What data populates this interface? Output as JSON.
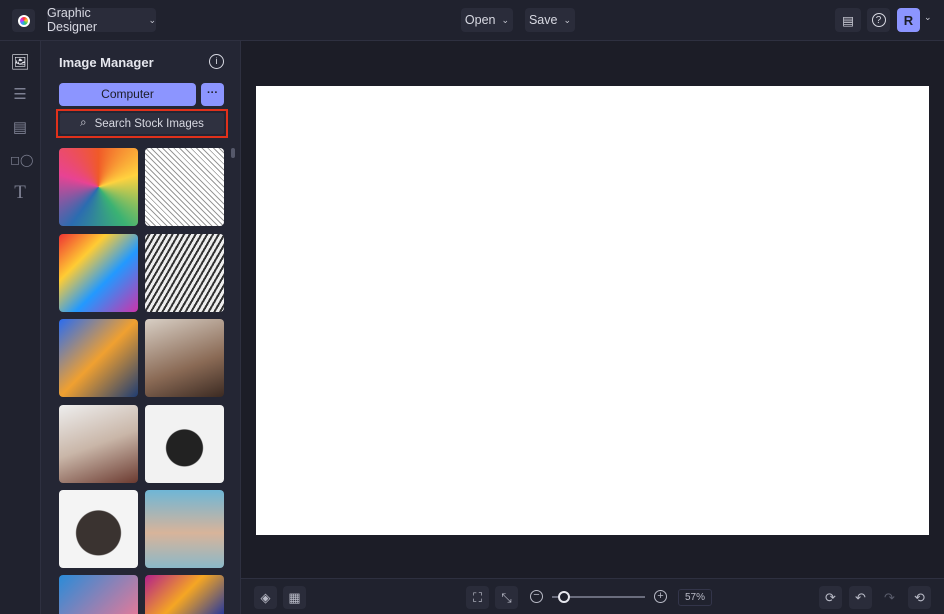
{
  "header": {
    "workspace": "Graphic Designer",
    "open": "Open",
    "save": "Save",
    "avatar_initial": "R"
  },
  "sidebar_rail": [
    "image-icon",
    "sliders-icon",
    "layout-icon",
    "shapes-icon",
    "text-icon"
  ],
  "panel": {
    "title": "Image Manager",
    "computer_button": "Computer",
    "more_button": "···",
    "search_button": "Search Stock Images"
  },
  "bottom": {
    "zoom": "57%",
    "zoom_fraction": 0.08
  },
  "colors": {
    "accent": "#8c95ff",
    "highlight": "#e0311b"
  }
}
